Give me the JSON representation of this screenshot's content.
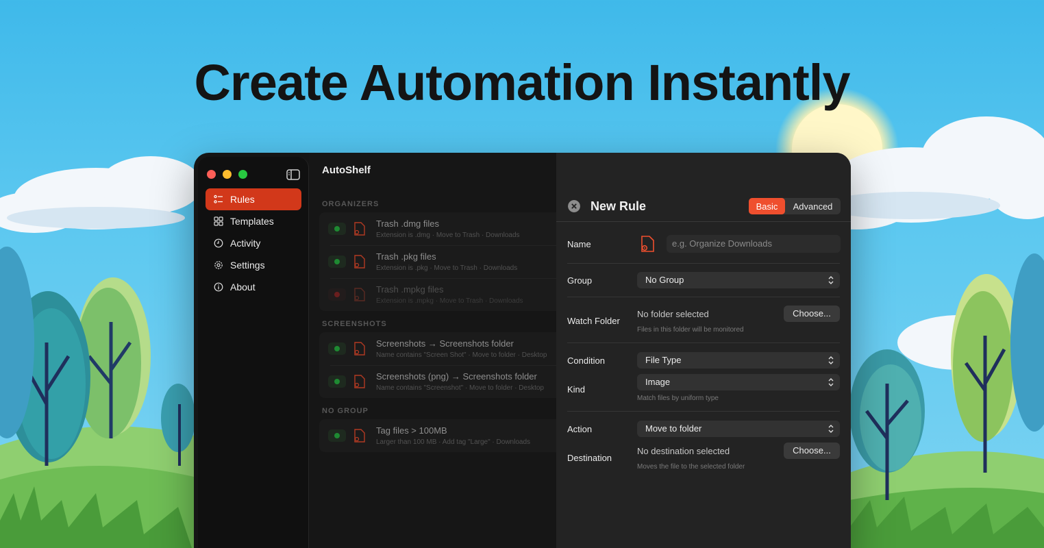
{
  "headline": "Create Automation Instantly",
  "colors": {
    "accent": "#d2381a",
    "toggle_on": "#1e8a32",
    "segment_on": "#ef4f2e"
  },
  "sidebar": {
    "items": [
      {
        "label": "Rules",
        "icon": "list-icon",
        "active": true
      },
      {
        "label": "Templates",
        "icon": "grid-icon"
      },
      {
        "label": "Activity",
        "icon": "clock-icon"
      },
      {
        "label": "Settings",
        "icon": "gear-icon"
      },
      {
        "label": "About",
        "icon": "info-icon"
      }
    ]
  },
  "main": {
    "title": "AutoShelf",
    "groups": [
      {
        "name": "ORGANIZERS",
        "rules": [
          {
            "title": "Trash .dmg files",
            "subtitle": "Extension is .dmg  ·  Move to Trash  ·  Downloads",
            "enabled": true
          },
          {
            "title": "Trash .pkg files",
            "subtitle": "Extension is .pkg  ·  Move to Trash  ·  Downloads",
            "enabled": true
          },
          {
            "title": "Trash .mpkg files",
            "subtitle": "Extension is .mpkg  ·  Move to Trash  ·  Downloads",
            "enabled": false
          }
        ]
      },
      {
        "name": "SCREENSHOTS",
        "rules": [
          {
            "title": "Screenshots → Screenshots folder",
            "subtitle": "Name contains \"Screen Shot\"  ·  Move to folder  ·  Desktop",
            "enabled": true
          },
          {
            "title": "Screenshots (png) → Screenshots folder",
            "subtitle": "Name contains \"Screenshot\"  ·  Move to folder  ·  Desktop",
            "enabled": true
          }
        ]
      },
      {
        "name": "NO GROUP",
        "rules": [
          {
            "title": "Tag files > 100MB",
            "subtitle": "Larger than 100 MB  ·  Add tag \"Large\"  ·  Downloads",
            "enabled": true
          }
        ]
      }
    ]
  },
  "panel": {
    "title": "New Rule",
    "mode_basic": "Basic",
    "mode_advanced": "Advanced",
    "mode_selected": "Basic",
    "name_label": "Name",
    "name_placeholder": "e.g. Organize Downloads",
    "group_label": "Group",
    "group_value": "No Group",
    "watch_label": "Watch Folder",
    "watch_value": "No folder selected",
    "watch_hint": "Files in this folder will be monitored",
    "choose_label": "Choose...",
    "condition_label": "Condition",
    "condition_value": "File Type",
    "kind_label": "Kind",
    "kind_value": "Image",
    "kind_hint": "Match files by uniform type",
    "action_label": "Action",
    "action_value": "Move to folder",
    "destination_label": "Destination",
    "destination_value": "No destination selected",
    "destination_hint": "Moves the file to the selected folder"
  }
}
